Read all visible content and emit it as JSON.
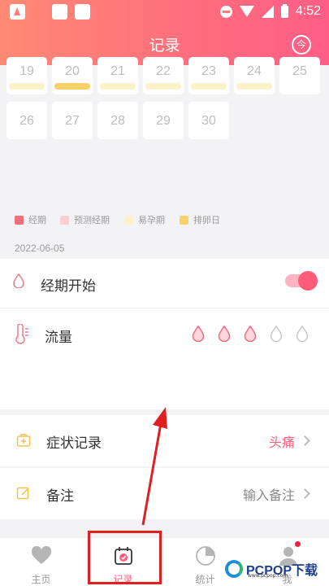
{
  "statusbar": {
    "time": "4:52"
  },
  "header": {
    "title": "记录",
    "share_icon": "share-icon"
  },
  "calendar": {
    "row1": [
      {
        "day": "19",
        "bar": "fertile"
      },
      {
        "day": "20",
        "bar": "ovulation"
      },
      {
        "day": "21",
        "bar": "fertile"
      },
      {
        "day": "22",
        "bar": "fertile"
      },
      {
        "day": "23",
        "bar": "fertile"
      },
      {
        "day": "24",
        "bar": "fertile"
      },
      {
        "day": "25",
        "bar": "none"
      }
    ],
    "row2": [
      "26",
      "27",
      "28",
      "29",
      "30"
    ]
  },
  "legend": [
    {
      "label": "经期",
      "color": "#f0707a"
    },
    {
      "label": "预测经期",
      "color": "#f8d0d4"
    },
    {
      "label": "易孕期",
      "color": "#fdf1c9"
    },
    {
      "label": "排卵日",
      "color": "#f7d26a"
    }
  ],
  "date": "2022-06-05",
  "period_start": {
    "label": "经期开始",
    "enabled": true
  },
  "flow": {
    "label": "流量",
    "level": 3,
    "max": 5
  },
  "symptoms": {
    "label": "症状记录",
    "value": "头痛"
  },
  "notes": {
    "label": "备注",
    "placeholder": "输入备注"
  },
  "tabs": [
    {
      "label": "主页",
      "icon": "heart-icon"
    },
    {
      "label": "记录",
      "icon": "calendar-icon",
      "active": true
    },
    {
      "label": "统计",
      "icon": "chart-icon"
    },
    {
      "label": "我",
      "icon": "user-icon"
    }
  ],
  "watermark": {
    "brand": "PCPOP下载",
    "sub": "www.pcpop.com"
  },
  "colors": {
    "accent": "#ff5d79",
    "annotation": "#e02020"
  }
}
